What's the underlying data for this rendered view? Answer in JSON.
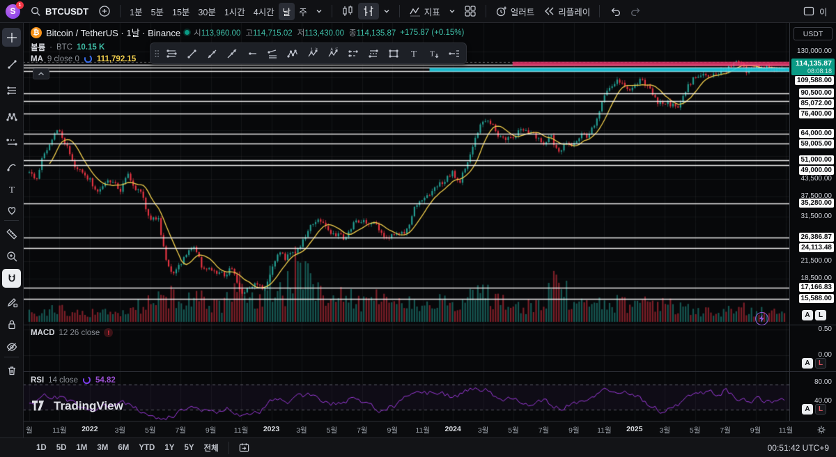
{
  "topbar": {
    "logo": {
      "letter": "S",
      "badge": "1"
    },
    "symbol": "BTCUSDT",
    "intervals": [
      {
        "label": "1분",
        "active": false
      },
      {
        "label": "5분",
        "active": false
      },
      {
        "label": "15분",
        "active": false
      },
      {
        "label": "30분",
        "active": false
      },
      {
        "label": "1시간",
        "active": false
      },
      {
        "label": "4시간",
        "active": false
      },
      {
        "label": "날",
        "active": true
      },
      {
        "label": "주",
        "active": false
      }
    ],
    "indicators_label": "지표",
    "alert_label": "얼러트",
    "replay_label": "리플레이",
    "layout_text": "이"
  },
  "symbol_row": {
    "title": "Bitcoin / TetherUS · 1날 · Binance",
    "ohlc": [
      {
        "label": "시",
        "value": "113,960.00"
      },
      {
        "label": "고",
        "value": "114,715.02"
      },
      {
        "label": "저",
        "value": "113,430.00"
      },
      {
        "label": "종",
        "value": "114,135.87"
      }
    ],
    "change": "+175.87 (+0.15%)"
  },
  "legend": {
    "volume": {
      "name": "볼륨",
      "sep": "·",
      "series": "BTC",
      "value": "10.15 K"
    },
    "ma": {
      "name": "MA",
      "params": "9 close 0",
      "value": "111,792.15"
    },
    "macd": {
      "name": "MACD",
      "params": "12 26 close"
    },
    "rsi": {
      "name": "RSI",
      "params": "14 close",
      "value": "54.82"
    }
  },
  "float_toolbar": [
    "drag-handle",
    "multiple-lines",
    "trend-line",
    "ray",
    "extended-line",
    "horizontal-ray",
    "regression-trend",
    "zigzag",
    "elliott-impulse-wave",
    "elliott-correction-wave",
    "parallel-channel",
    "disjoint-channel",
    "rectangle",
    "text",
    "anchored-text",
    "price-note"
  ],
  "sidebar_tools": [
    "crosshair",
    "trend-line",
    "fib-retracement",
    "xabcd-pattern",
    "prediction",
    "brush",
    "text",
    "emoji",
    "divider",
    "ruler",
    "zoom-in",
    "magnet",
    "drawing-lock",
    "lock-all",
    "hide-all",
    "divider",
    "remove-all"
  ],
  "price_scale": {
    "currency": "USDT",
    "ticks": [
      {
        "text": "130,000.00",
        "price": 130000
      },
      {
        "text": "43,500.00",
        "price": 43500
      },
      {
        "text": "37,500.00",
        "price": 37500
      },
      {
        "text": "31,500.00",
        "price": 31500
      },
      {
        "text": "21,500.00",
        "price": 21500
      },
      {
        "text": "18,500.00",
        "price": 18500
      }
    ],
    "levels": [
      {
        "text": "109,588.00",
        "price": 109588
      },
      {
        "text": "90,500.00",
        "price": 90500
      },
      {
        "text": "85,072.00",
        "price": 85072
      },
      {
        "text": "76,400.00",
        "price": 76400
      },
      {
        "text": "64,000.00",
        "price": 64000
      },
      {
        "text": "59,005.00",
        "price": 59005
      },
      {
        "text": "51,000.00",
        "price": 51000
      },
      {
        "text": "49,000.00",
        "price": 49000
      },
      {
        "text": "35,280.00",
        "price": 35280
      },
      {
        "text": "26,386.87",
        "price": 26386.87
      },
      {
        "text": "24,113.48",
        "price": 24113.48
      },
      {
        "text": "17,166.83",
        "price": 17166.83
      },
      {
        "text": "15,588.00",
        "price": 15588
      }
    ],
    "current": {
      "text": "114,135.87",
      "countdown": "08:08:18"
    },
    "macd_ticks": [
      "0.50",
      "0.00"
    ],
    "rsi_ticks": [
      "80.00",
      "40.00"
    ],
    "auto_label": "A",
    "log_label": "L"
  },
  "time_axis": {
    "labels": [
      "월",
      "11월",
      "2022",
      "3월",
      "5월",
      "7월",
      "9월",
      "11월",
      "2023",
      "3월",
      "5월",
      "7월",
      "9월",
      "11월",
      "2024",
      "3월",
      "5월",
      "7월",
      "9월",
      "11월",
      "2025",
      "3월",
      "5월",
      "7월",
      "9월",
      "11월"
    ],
    "year_indexes": [
      2,
      8,
      14,
      20
    ]
  },
  "bottom_bar": {
    "ranges": [
      "1D",
      "5D",
      "1M",
      "3M",
      "6M",
      "YTD",
      "1Y",
      "5Y",
      "전체"
    ],
    "clock": "00:51:42 UTC+9"
  },
  "watermark": "TradingView",
  "chart_data": {
    "type": "candlestick",
    "title": "Bitcoin / TetherUS · 1날 · Binance",
    "symbol": "BTCUSDT",
    "exchange": "Binance",
    "interval": "1날",
    "y_scale": "log",
    "ylim": [
      13000,
      148000
    ],
    "x_start": "2021-09",
    "x_end": "2025-11",
    "x_step": "half-month",
    "price_path": [
      46000,
      43800,
      54700,
      61300,
      66500,
      57000,
      48900,
      46200,
      43100,
      38500,
      42400,
      43200,
      39300,
      45500,
      40500,
      37700,
      30100,
      31800,
      22500,
      18900,
      20800,
      23300,
      24300,
      20050,
      20200,
      19400,
      19100,
      20500,
      16200,
      17100,
      17800,
      16550,
      19900,
      23100,
      22100,
      23150,
      24700,
      28500,
      30400,
      29250,
      27000,
      27200,
      25900,
      30480,
      30300,
      29230,
      29400,
      25930,
      26600,
      26970,
      27950,
      34650,
      36700,
      37700,
      41200,
      42270,
      46300,
      42580,
      49700,
      61200,
      71450,
      71330,
      63800,
      60640,
      61500,
      67530,
      66000,
      62680,
      57900,
      64620,
      54000,
      58970,
      58100,
      63330,
      62800,
      70220,
      88700,
      96450,
      101200,
      93430,
      94600,
      102400,
      96600,
      84350,
      83700,
      82550,
      79600,
      94180,
      103700,
      104600,
      105700,
      107140,
      109700,
      115760,
      119500,
      108240,
      112100,
      114000,
      112500,
      111000,
      114135.87
    ],
    "volume_profile": [
      0.12,
      0.14,
      0.16,
      0.13,
      0.12,
      0.12,
      0.14,
      0.13,
      0.28,
      0.38,
      0.26,
      0.3,
      0.27,
      0.25,
      0.5,
      0.38,
      0.52,
      0.44,
      0.72,
      0.4,
      0.33,
      0.35,
      0.25,
      0.3,
      0.22,
      0.26,
      0.3,
      0.28,
      0.24,
      0.32,
      0.38,
      0.26,
      0.22,
      0.2,
      0.2,
      0.6,
      0.22,
      0.2,
      0.32,
      0.24,
      0.22,
      0.3,
      0.24,
      0.2,
      0.16,
      0.14,
      0.16,
      0.2,
      0.14,
      0.13,
      0.1
    ],
    "rsi_path": [
      48,
      62,
      60,
      45,
      38,
      46,
      50,
      40,
      32,
      26,
      42,
      38,
      36,
      42,
      30,
      33,
      58,
      54,
      62,
      60,
      48,
      56,
      52,
      40,
      46,
      60,
      64,
      68,
      58,
      72,
      74,
      54,
      60,
      50,
      54,
      42,
      52,
      60,
      80,
      66,
      64,
      42,
      38,
      52,
      66,
      64,
      72,
      50,
      58,
      50,
      54.82
    ],
    "current_ohlc": {
      "open": 113960.0,
      "high": 114715.02,
      "low": 113430.0,
      "close": 114135.87,
      "change": 175.87,
      "change_pct": 0.15
    },
    "ma": {
      "period": 9,
      "source": "close",
      "value": 111792.15
    },
    "rsi": {
      "period": 14,
      "source": "close",
      "value": 54.82
    },
    "macd": {
      "fast": 12,
      "slow": 26,
      "source": "close",
      "error": true
    },
    "volume_last": "10.15 K",
    "levels": [
      109588,
      90500,
      85072,
      76400,
      64000,
      59005,
      51000,
      49000,
      35280,
      26386.87,
      24113.48,
      17166.83,
      15588
    ],
    "levels_unlabeled": [
      115900,
      113300
    ],
    "dashed_level": 118600,
    "zones": [
      {
        "name": "supply-zone",
        "color": "#f2366f",
        "alpha": 0.8,
        "from": 114600,
        "to": 118800,
        "x_frac": 0.64
      },
      {
        "name": "demand-zone",
        "color": "#1ecbe0",
        "alpha": 0.9,
        "from": 109300,
        "to": 112600,
        "x_frac": 0.53
      }
    ],
    "rsi_bands": [
      80,
      40
    ],
    "style": {
      "up": "#26a69a",
      "down": "#f23645",
      "ma": "#f2cf4d",
      "rsi": "#a03be0",
      "level": "#ffffff"
    }
  }
}
